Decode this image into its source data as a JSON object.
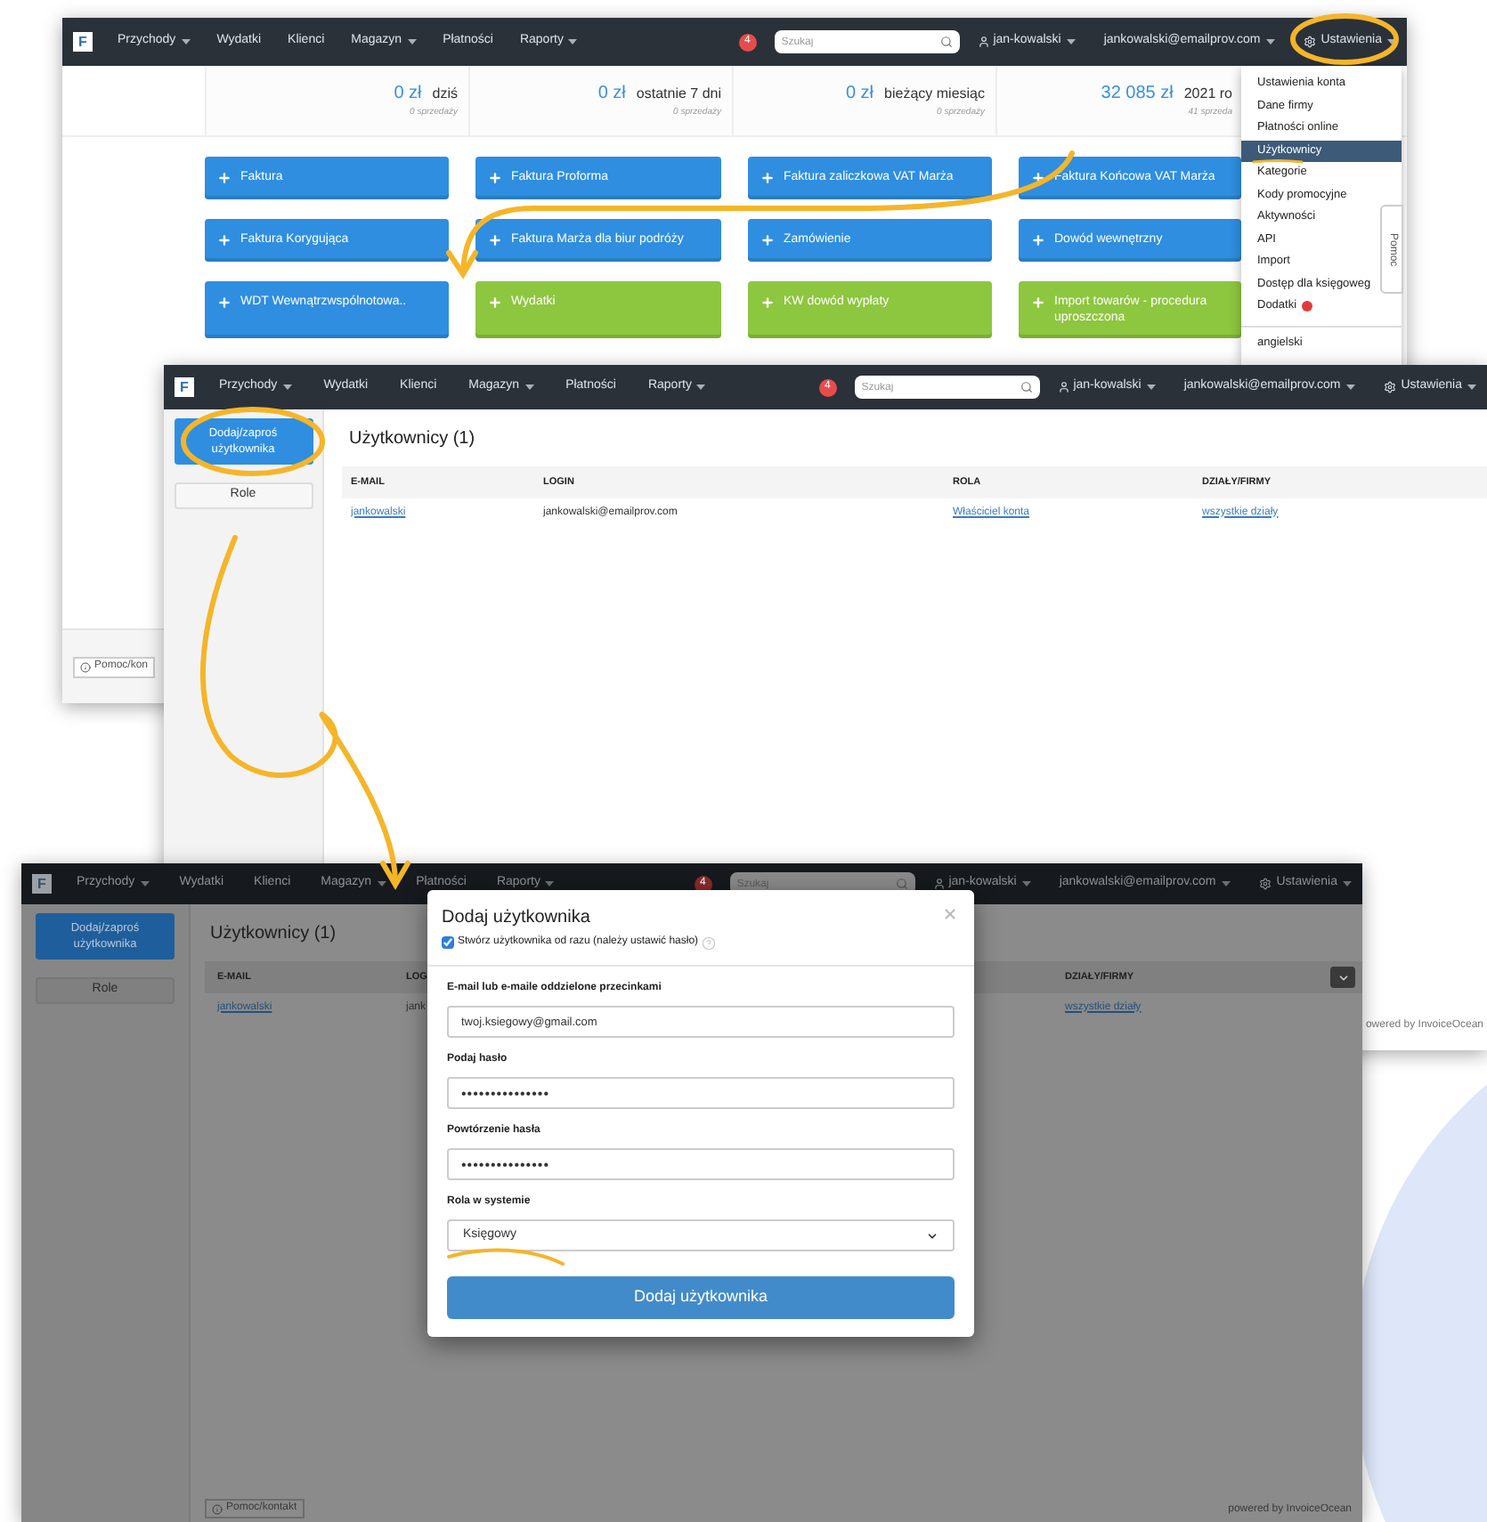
{
  "dashboard_window": {
    "nav": {
      "logo": "F",
      "items": [
        {
          "label": "Przychody",
          "dropdown": true
        },
        {
          "label": "Wydatki",
          "dropdown": false
        },
        {
          "label": "Klienci",
          "dropdown": false
        },
        {
          "label": "Magazyn",
          "dropdown": true
        },
        {
          "label": "Płatności",
          "dropdown": false
        },
        {
          "label": "Raporty",
          "dropdown": true
        }
      ],
      "notifications": "4",
      "search_placeholder": "Szukaj",
      "user": "jan-kowalski",
      "email": "jankowalski@emailprov.com",
      "settings": "Ustawienia"
    },
    "stats": [
      {
        "amount": "0 zł",
        "period": "dziś",
        "sales": "0 sprzedaży"
      },
      {
        "amount": "0 zł",
        "period": "ostatnie 7 dni",
        "sales": "0 sprzedaży"
      },
      {
        "amount": "0 zł",
        "period": "bieżący miesiąc",
        "sales": "0 sprzedaży"
      },
      {
        "amount": "32 085 zł",
        "period": "2021 ro",
        "sales": "41 sprzeda"
      }
    ],
    "buttons": [
      {
        "label": "Faktura",
        "color": "#2f8ee0"
      },
      {
        "label": "Faktura Proforma",
        "color": "#2f8ee0"
      },
      {
        "label": "Faktura zaliczkowa VAT Marża",
        "color": "#2f8ee0"
      },
      {
        "label": "Faktura Końcowa VAT Marża",
        "color": "#2f8ee0"
      },
      {
        "label": "Faktura Korygująca",
        "color": "#2f8ee0"
      },
      {
        "label": "Faktura Marża dla biur podróży",
        "color": "#2f8ee0"
      },
      {
        "label": "Zamówienie",
        "color": "#2f8ee0"
      },
      {
        "label": "Dowód wewnętrzny",
        "color": "#2f8ee0"
      },
      {
        "label": "WDT Wewnątrzwspólnotowa..",
        "color": "#2f8ee0"
      },
      {
        "label": "Wydatki",
        "color": "#8dc63f"
      },
      {
        "label": "KW dowód wypłaty",
        "color": "#8dc63f"
      },
      {
        "label": "Import towarów - procedura uproszczona",
        "color": "#8dc63f"
      }
    ],
    "settings_menu": {
      "items": [
        {
          "label": "Ustawienia konta",
          "selected": false,
          "alert": false
        },
        {
          "label": "Dane firmy",
          "selected": false,
          "alert": false
        },
        {
          "label": "Płatności online",
          "selected": false,
          "alert": false
        },
        {
          "label": "Użytkownicy",
          "selected": true,
          "alert": false
        },
        {
          "label": "Kategorie",
          "selected": false,
          "alert": false
        },
        {
          "label": "Kody promocyjne",
          "selected": false,
          "alert": false
        },
        {
          "label": "Aktywności",
          "selected": false,
          "alert": false
        },
        {
          "label": "API",
          "selected": false,
          "alert": false
        },
        {
          "label": "Import",
          "selected": false,
          "alert": false
        },
        {
          "label": "Dostęp dla księgoweg",
          "selected": false,
          "alert": false
        },
        {
          "label": "Dodatki",
          "selected": false,
          "alert": true
        }
      ],
      "languages": [
        "angielski"
      ]
    },
    "help_tab": "Pomoc",
    "footer_help": "Pomoc/kon"
  },
  "users_window": {
    "nav": {
      "logo": "F",
      "items": [
        {
          "label": "Przychody",
          "dropdown": true
        },
        {
          "label": "Wydatki",
          "dropdown": false
        },
        {
          "label": "Klienci",
          "dropdown": false
        },
        {
          "label": "Magazyn",
          "dropdown": true
        },
        {
          "label": "Płatności",
          "dropdown": false
        },
        {
          "label": "Raporty",
          "dropdown": true
        }
      ],
      "notifications": "4",
      "search_placeholder": "Szukaj",
      "user": "jan-kowalski",
      "email": "jankowalski@emailprov.com",
      "settings": "Ustawienia"
    },
    "sidebar": {
      "primary_button": "Dodaj/zaproś użytkownika",
      "secondary_button": "Role"
    },
    "title": "Użytkownicy (1)",
    "table": {
      "columns": [
        "E-MAIL",
        "LOGIN",
        "ROLA",
        "DZIAŁY/FIRMY"
      ],
      "rows": [
        [
          {
            "text": "jankowalski",
            "link": true
          },
          {
            "text": "jankowalski@emailprov.com",
            "link": false
          },
          {
            "text": "Właściciel konta",
            "link": true
          },
          {
            "text": "wszystkie działy",
            "link": true
          }
        ]
      ]
    },
    "footer": "owered by InvoiceOcean"
  },
  "add_user_window": {
    "nav": {
      "logo": "F",
      "items": [
        {
          "label": "Przychody",
          "dropdown": true
        },
        {
          "label": "Wydatki",
          "dropdown": false
        },
        {
          "label": "Klienci",
          "dropdown": false
        },
        {
          "label": "Magazyn",
          "dropdown": true
        },
        {
          "label": "Płatności",
          "dropdown": false
        },
        {
          "label": "Raporty",
          "dropdown": true
        }
      ],
      "notifications": "4",
      "search_placeholder": "Szukaj",
      "user": "jan-kowalski",
      "email": "jankowalski@emailprov.com",
      "settings": "Ustawienia"
    },
    "sidebar": {
      "primary_button": "Dodaj/zaproś użytkownika",
      "secondary_button": "Role"
    },
    "title": "Użytkownicy (1)",
    "table": {
      "columns": [
        "E-MAIL",
        "LOG",
        "DZIAŁY/FIRMY"
      ],
      "rows": [
        [
          {
            "text": "jankowalski",
            "link": true
          },
          {
            "text": "jank",
            "link": false
          },
          {
            "text": "wszystkie działy",
            "link": true
          }
        ]
      ]
    },
    "footer_help": "Pomoc/kontakt",
    "footer": "powered by InvoiceOcean",
    "modal": {
      "title": "Dodaj użytkownika",
      "create_now": {
        "label": "Stwórz użytkownika od razu (należy ustawić hasło)",
        "checked": true
      },
      "fields": [
        {
          "label": "E-mail lub e-maile oddzielone przecinkami",
          "kind": "text",
          "value": "twoj.ksiegowy@gmail.com"
        },
        {
          "label": "Podaj hasło",
          "kind": "password",
          "value": "•••••••••••••••"
        },
        {
          "label": "Powtórzenie hasła",
          "kind": "password",
          "value": "•••••••••••••••"
        },
        {
          "label": "Rola w systemie",
          "kind": "select",
          "value": "Księgowy"
        }
      ],
      "submit": "Dodaj użytkownika"
    }
  }
}
